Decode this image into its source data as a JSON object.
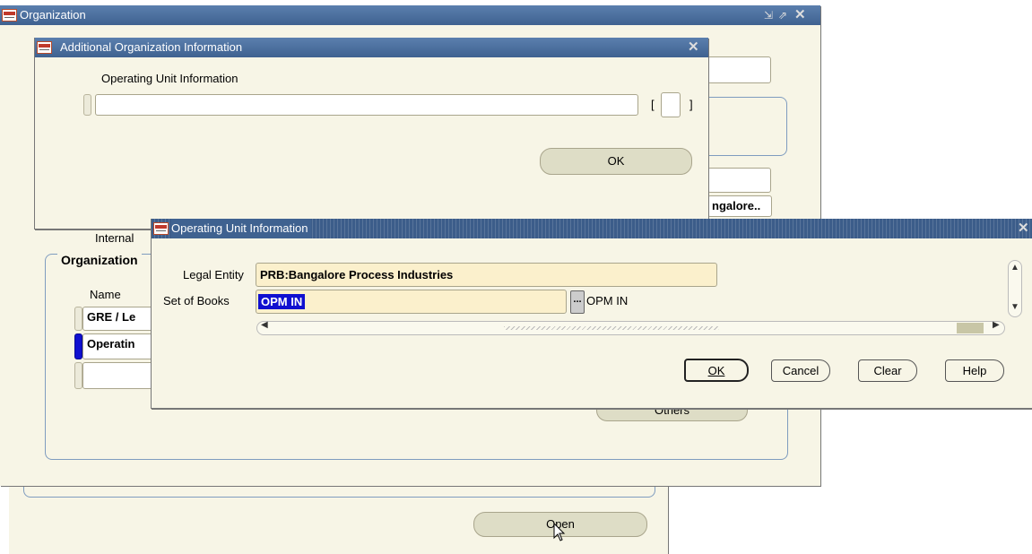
{
  "org_window": {
    "title": "Organization",
    "internal_label": "Internal",
    "organization_section": "Organization",
    "name_header": "Name",
    "rows": [
      "GRE / Le",
      "Operatin"
    ],
    "bangalore_text": "ngalore..",
    "others_button": "Others",
    "open_button": "Open"
  },
  "additional_window": {
    "title": "Additional Organization Information",
    "field_label": "Operating Unit Information",
    "bracket_left": "[",
    "bracket_right": "]",
    "ok_button": "OK"
  },
  "ou_window": {
    "title": "Operating Unit Information",
    "legal_entity_label": "Legal Entity",
    "legal_entity_value": "PRB:Bangalore Process Industries",
    "set_of_books_label": "Set of Books",
    "set_of_books_value": "OPM IN",
    "set_of_books_desc": "OPM IN",
    "lov_button": "...",
    "ok": "OK",
    "cancel": "Cancel",
    "clear": "Clear",
    "help": "Help"
  },
  "colors": {
    "title_bar": "#3f6290",
    "window_bg": "#f7f5e6",
    "required_field": "#fbf0cc",
    "selection": "#1010d0"
  }
}
